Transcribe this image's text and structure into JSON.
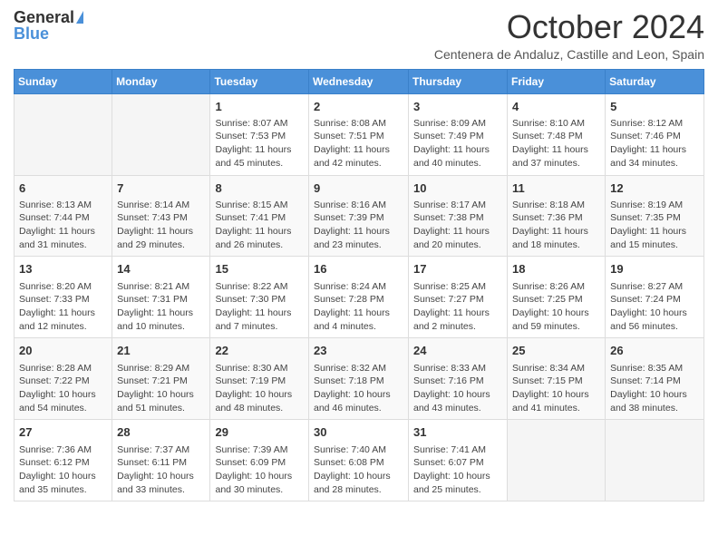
{
  "logo": {
    "general": "General",
    "blue": "Blue"
  },
  "header": {
    "month": "October 2024",
    "location": "Centenera de Andaluz, Castille and Leon, Spain"
  },
  "weekdays": [
    "Sunday",
    "Monday",
    "Tuesday",
    "Wednesday",
    "Thursday",
    "Friday",
    "Saturday"
  ],
  "weeks": [
    [
      {
        "day": "",
        "info": ""
      },
      {
        "day": "",
        "info": ""
      },
      {
        "day": "1",
        "info": "Sunrise: 8:07 AM\nSunset: 7:53 PM\nDaylight: 11 hours and 45 minutes."
      },
      {
        "day": "2",
        "info": "Sunrise: 8:08 AM\nSunset: 7:51 PM\nDaylight: 11 hours and 42 minutes."
      },
      {
        "day": "3",
        "info": "Sunrise: 8:09 AM\nSunset: 7:49 PM\nDaylight: 11 hours and 40 minutes."
      },
      {
        "day": "4",
        "info": "Sunrise: 8:10 AM\nSunset: 7:48 PM\nDaylight: 11 hours and 37 minutes."
      },
      {
        "day": "5",
        "info": "Sunrise: 8:12 AM\nSunset: 7:46 PM\nDaylight: 11 hours and 34 minutes."
      }
    ],
    [
      {
        "day": "6",
        "info": "Sunrise: 8:13 AM\nSunset: 7:44 PM\nDaylight: 11 hours and 31 minutes."
      },
      {
        "day": "7",
        "info": "Sunrise: 8:14 AM\nSunset: 7:43 PM\nDaylight: 11 hours and 29 minutes."
      },
      {
        "day": "8",
        "info": "Sunrise: 8:15 AM\nSunset: 7:41 PM\nDaylight: 11 hours and 26 minutes."
      },
      {
        "day": "9",
        "info": "Sunrise: 8:16 AM\nSunset: 7:39 PM\nDaylight: 11 hours and 23 minutes."
      },
      {
        "day": "10",
        "info": "Sunrise: 8:17 AM\nSunset: 7:38 PM\nDaylight: 11 hours and 20 minutes."
      },
      {
        "day": "11",
        "info": "Sunrise: 8:18 AM\nSunset: 7:36 PM\nDaylight: 11 hours and 18 minutes."
      },
      {
        "day": "12",
        "info": "Sunrise: 8:19 AM\nSunset: 7:35 PM\nDaylight: 11 hours and 15 minutes."
      }
    ],
    [
      {
        "day": "13",
        "info": "Sunrise: 8:20 AM\nSunset: 7:33 PM\nDaylight: 11 hours and 12 minutes."
      },
      {
        "day": "14",
        "info": "Sunrise: 8:21 AM\nSunset: 7:31 PM\nDaylight: 11 hours and 10 minutes."
      },
      {
        "day": "15",
        "info": "Sunrise: 8:22 AM\nSunset: 7:30 PM\nDaylight: 11 hours and 7 minutes."
      },
      {
        "day": "16",
        "info": "Sunrise: 8:24 AM\nSunset: 7:28 PM\nDaylight: 11 hours and 4 minutes."
      },
      {
        "day": "17",
        "info": "Sunrise: 8:25 AM\nSunset: 7:27 PM\nDaylight: 11 hours and 2 minutes."
      },
      {
        "day": "18",
        "info": "Sunrise: 8:26 AM\nSunset: 7:25 PM\nDaylight: 10 hours and 59 minutes."
      },
      {
        "day": "19",
        "info": "Sunrise: 8:27 AM\nSunset: 7:24 PM\nDaylight: 10 hours and 56 minutes."
      }
    ],
    [
      {
        "day": "20",
        "info": "Sunrise: 8:28 AM\nSunset: 7:22 PM\nDaylight: 10 hours and 54 minutes."
      },
      {
        "day": "21",
        "info": "Sunrise: 8:29 AM\nSunset: 7:21 PM\nDaylight: 10 hours and 51 minutes."
      },
      {
        "day": "22",
        "info": "Sunrise: 8:30 AM\nSunset: 7:19 PM\nDaylight: 10 hours and 48 minutes."
      },
      {
        "day": "23",
        "info": "Sunrise: 8:32 AM\nSunset: 7:18 PM\nDaylight: 10 hours and 46 minutes."
      },
      {
        "day": "24",
        "info": "Sunrise: 8:33 AM\nSunset: 7:16 PM\nDaylight: 10 hours and 43 minutes."
      },
      {
        "day": "25",
        "info": "Sunrise: 8:34 AM\nSunset: 7:15 PM\nDaylight: 10 hours and 41 minutes."
      },
      {
        "day": "26",
        "info": "Sunrise: 8:35 AM\nSunset: 7:14 PM\nDaylight: 10 hours and 38 minutes."
      }
    ],
    [
      {
        "day": "27",
        "info": "Sunrise: 7:36 AM\nSunset: 6:12 PM\nDaylight: 10 hours and 35 minutes."
      },
      {
        "day": "28",
        "info": "Sunrise: 7:37 AM\nSunset: 6:11 PM\nDaylight: 10 hours and 33 minutes."
      },
      {
        "day": "29",
        "info": "Sunrise: 7:39 AM\nSunset: 6:09 PM\nDaylight: 10 hours and 30 minutes."
      },
      {
        "day": "30",
        "info": "Sunrise: 7:40 AM\nSunset: 6:08 PM\nDaylight: 10 hours and 28 minutes."
      },
      {
        "day": "31",
        "info": "Sunrise: 7:41 AM\nSunset: 6:07 PM\nDaylight: 10 hours and 25 minutes."
      },
      {
        "day": "",
        "info": ""
      },
      {
        "day": "",
        "info": ""
      }
    ]
  ]
}
